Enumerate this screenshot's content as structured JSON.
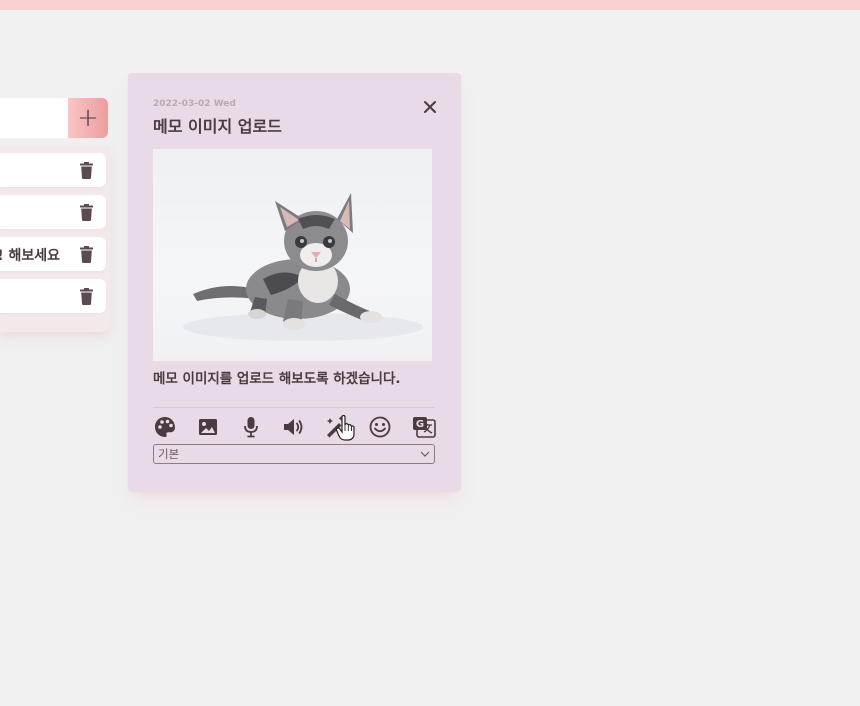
{
  "memo_list": {
    "add_label": "+",
    "items": [
      {
        "text": ""
      },
      {
        "text": ""
      },
      {
        "text": "해보세요 !"
      },
      {
        "text": ""
      }
    ]
  },
  "memo_card": {
    "date": "2022-03-02 Wed",
    "title": "메모 이미지 업로드",
    "body": "메모 이미지를 업로드 해보도록 하겠습니다.",
    "font_select": "기본"
  },
  "toolbar": {
    "icons": [
      "palette-icon",
      "image-icon",
      "microphone-icon",
      "speaker-icon",
      "magic-wand-icon",
      "smiley-icon",
      "translate-icon"
    ]
  },
  "colors": {
    "accent": "#ee9d9f",
    "card_bg": "#e8dae6",
    "text": "#4a3a42",
    "top_bar": "#f7d0d2"
  }
}
